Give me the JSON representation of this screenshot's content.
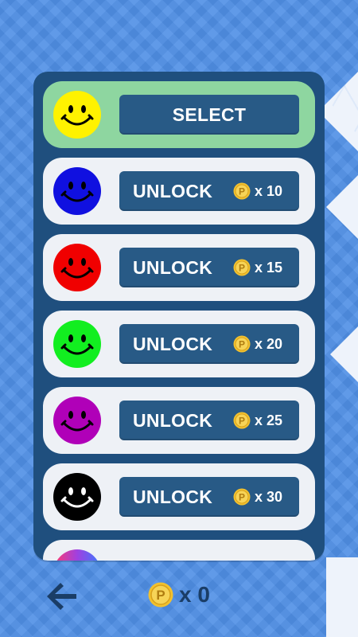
{
  "skins": [
    {
      "color": "#fff200",
      "selected": true,
      "label": "SELECT"
    },
    {
      "color": "#1010e0",
      "label": "UNLOCK",
      "price": "x 10"
    },
    {
      "color": "#f00000",
      "label": "UNLOCK",
      "price": "x 15"
    },
    {
      "color": "#12ee20",
      "label": "UNLOCK",
      "price": "x 20"
    },
    {
      "color": "#b000b8",
      "label": "UNLOCK",
      "price": "x 25"
    },
    {
      "color": "#000000",
      "label": "UNLOCK",
      "price": "x 30"
    }
  ],
  "footer": {
    "back_icon": "back-arrow-icon",
    "coin_icon": "coin-icon",
    "coin_count": "x 0"
  },
  "colors": {
    "panel": "#1f4f7e",
    "button": "#285a86",
    "selected_row": "#8ed6a0",
    "row": "#eef1f6",
    "coin": "#f2c12e",
    "background": "#4f8fe6"
  }
}
